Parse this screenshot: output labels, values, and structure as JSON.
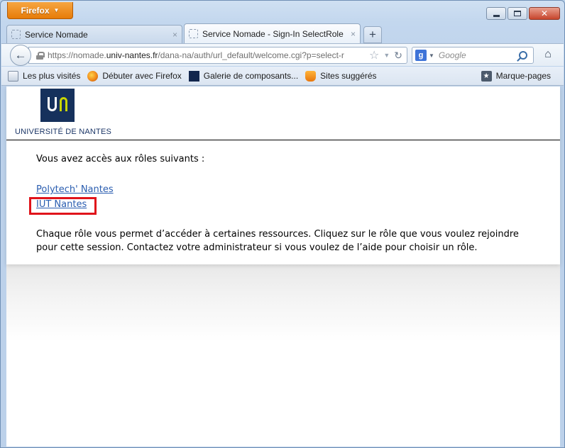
{
  "window": {
    "app_button": "Firefox",
    "minimize_symbol": "",
    "maximize_symbol": "",
    "close_symbol": "✕"
  },
  "tabs": [
    {
      "label": "Service Nomade",
      "active": false
    },
    {
      "label": "Service Nomade - Sign-In SelectRole",
      "active": true
    }
  ],
  "tab_close_symbol": "×",
  "new_tab_symbol": "+",
  "navbar": {
    "back_symbol": "←",
    "url_prefix": "https://nomade.",
    "url_domain": "univ-nantes.fr",
    "url_rest": "/dana-na/auth/url_default/welcome.cgi?p=select-r",
    "search_placeholder": "Google",
    "search_engine_letter": "g"
  },
  "bookmarks": [
    {
      "label": "Les plus visités",
      "icon": "folder-icon"
    },
    {
      "label": "Débuter avec Firefox",
      "icon": "firefox-icon"
    },
    {
      "label": "Galerie de composants...",
      "icon": "gallery-icon"
    },
    {
      "label": "Sites suggérés",
      "icon": "suggested-sites-icon"
    }
  ],
  "bookmarks_menu": "Marque-pages",
  "page": {
    "university_name": "UNIVERSITÉ DE NANTES",
    "intro": "Vous avez accès aux rôles suivants :",
    "roles": [
      "Polytech' Nantes",
      "IUT Nantes"
    ],
    "description": "Chaque rôle vous permet d’accéder à certaines ressources. Cliquez sur le rôle que vous voulez rejoindre pour cette session. Contactez votre administrateur si vous voulez de l’aide pour choisir un rôle."
  },
  "colors": {
    "firefox_orange": "#e77b08",
    "link_blue": "#2a5db0",
    "highlight_red": "#e0141b",
    "university_navy": "#16315c",
    "university_lime": "#c9d600"
  }
}
